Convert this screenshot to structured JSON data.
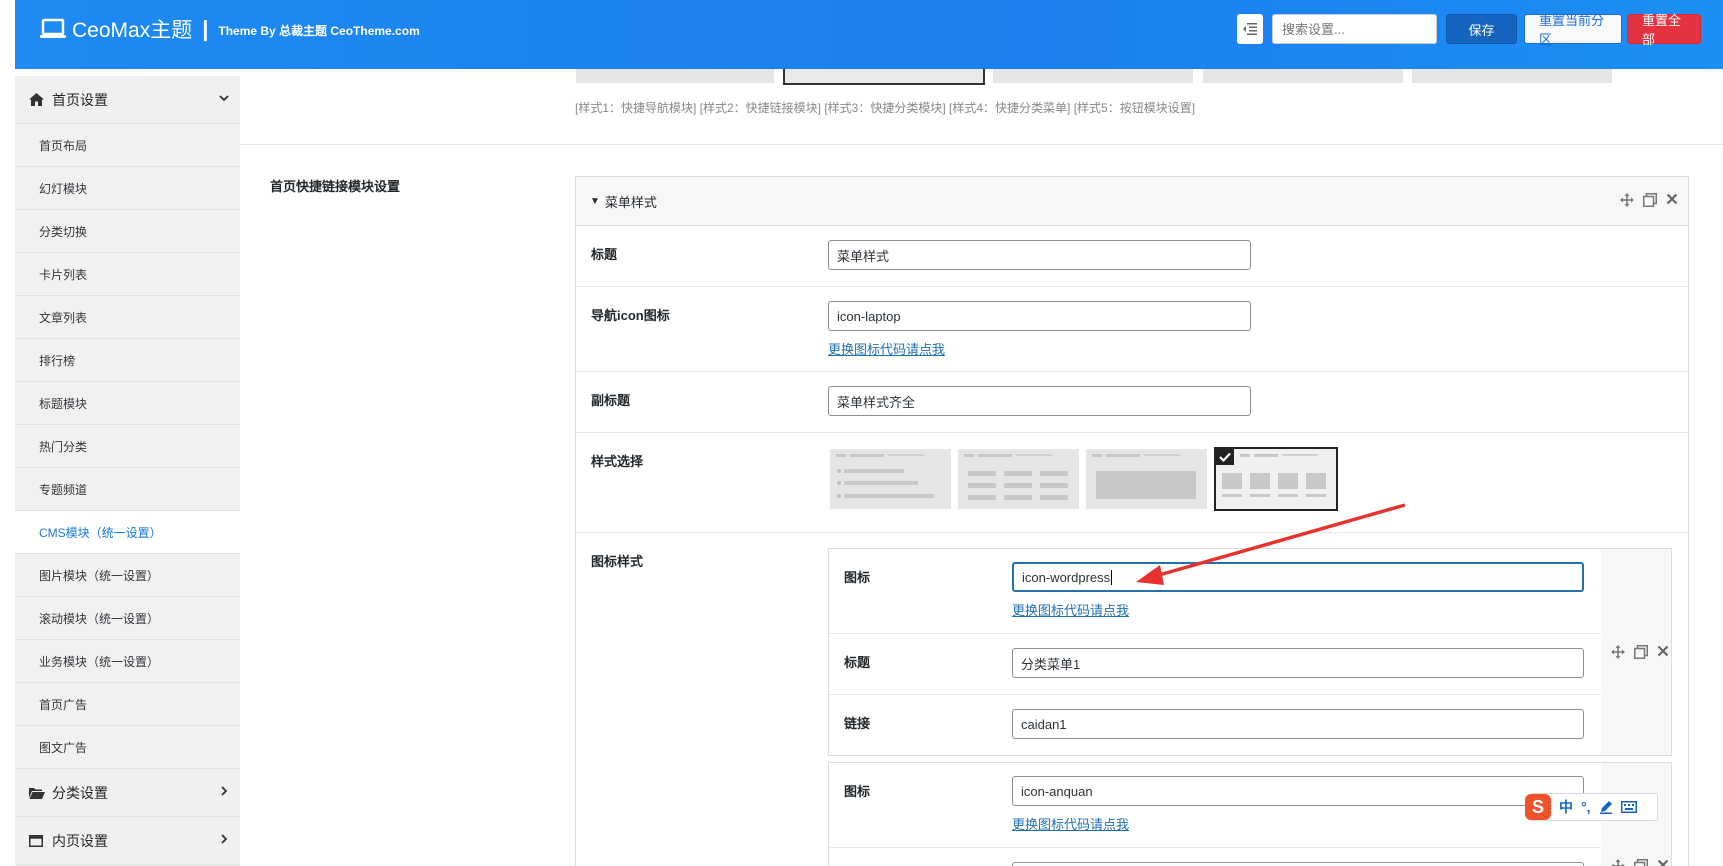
{
  "header": {
    "brand": "CeoMax主题",
    "tagline": "Theme By 总裁主题 CeoTheme.com",
    "search_placeholder": "搜索设置...",
    "save_label": "保存",
    "reset_section_label": "重置当前分区",
    "reset_all_label": "重置全部"
  },
  "sidebar": {
    "home_group": "首页设置",
    "items": [
      {
        "label": "首页布局"
      },
      {
        "label": "幻灯模块"
      },
      {
        "label": "分类切换"
      },
      {
        "label": "卡片列表"
      },
      {
        "label": "文章列表"
      },
      {
        "label": "排行榜"
      },
      {
        "label": "标题模块"
      },
      {
        "label": "热门分类"
      },
      {
        "label": "专题频道"
      },
      {
        "label": "CMS模块（统一设置）",
        "active": true
      },
      {
        "label": "图片模块（统一设置）"
      },
      {
        "label": "滚动模块（统一设置）"
      },
      {
        "label": "业务模块（统一设置）"
      },
      {
        "label": "首页广告"
      },
      {
        "label": "图文广告"
      }
    ],
    "category_group": "分类设置",
    "inner_group": "内页设置"
  },
  "main": {
    "style_note": "[样式1：快捷导航模块] [样式2：快捷链接模块] [样式3：快捷分类模块] [样式4：快捷分类菜单] [样式5：按钮模块设置]",
    "section_label": "首页快捷链接模块设置",
    "panel": {
      "title": "菜单样式",
      "fields": {
        "title_label": "标题",
        "title_value": "菜单样式",
        "nav_icon_label": "导航icon图标",
        "nav_icon_value": "icon-laptop",
        "change_icon_link": "更换图标代码请点我",
        "subtitle_label": "副标题",
        "subtitle_value": "菜单样式齐全",
        "style_label": "样式选择",
        "icon_style_label": "图标样式"
      },
      "icon_groups": [
        {
          "icon_label": "图标",
          "icon_value": "icon-wordpress",
          "link_text": "更换图标代码请点我",
          "title_label": "标题",
          "title_value": "分类菜单1",
          "url_label": "链接",
          "url_value": "caidan1"
        },
        {
          "icon_label": "图标",
          "icon_value": "icon-anquan",
          "link_text": "更换图标代码请点我"
        }
      ]
    }
  },
  "ime": {
    "mode": "中",
    "punct": "°,"
  }
}
